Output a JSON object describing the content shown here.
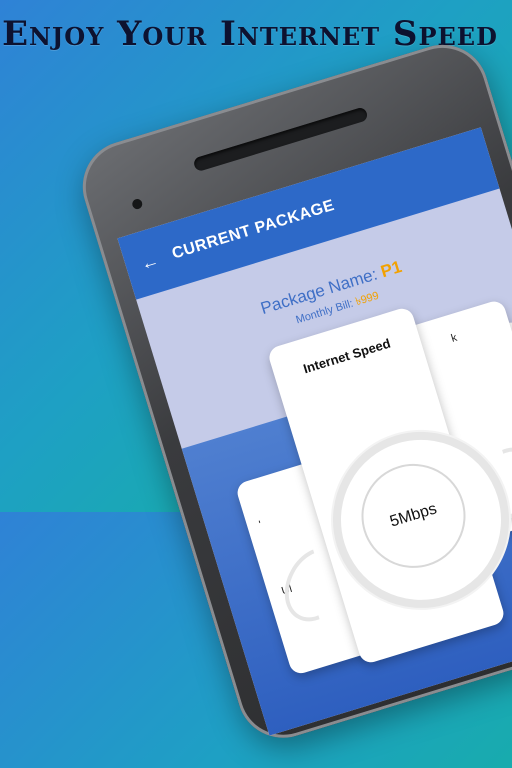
{
  "headline": "Enjoy Your Internet Speed",
  "appbar": {
    "back_icon": "arrow-left-icon",
    "title": "CURRENT PACKAGE"
  },
  "package": {
    "name_label": "Package Name:",
    "name_value": "P1",
    "bill_label": "Monthly Bill:",
    "bill_value": "৳999"
  },
  "speed_card": {
    "title": "Internet Speed",
    "value": "5Mbps"
  },
  "fragments": {
    "left_card": "Ul",
    "left_small": "'",
    "right_card": "k"
  },
  "colors": {
    "appbar": "#2d69c8",
    "accent": "#f2a100",
    "text_blue": "#3f6fc6",
    "screen_bg": "#c5cbe8"
  }
}
